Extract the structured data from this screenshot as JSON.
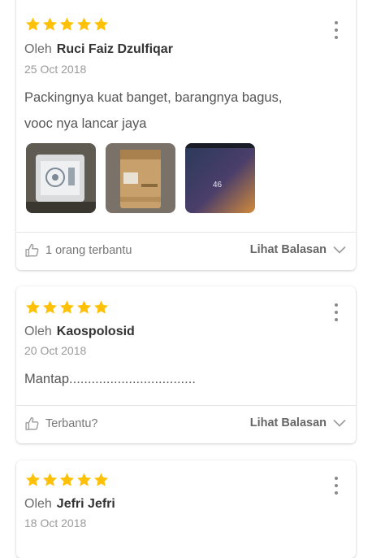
{
  "reviews": [
    {
      "rating": 5,
      "by_label": "Oleh",
      "author": "Ruci Faiz Dzulfiqar",
      "date": "25 Oct 2018",
      "text_line1": "Packingnya kuat banget, barangnya bagus,",
      "text_line2": "vooc nya lancar jaya",
      "photo_time": "46",
      "helpful": "1 orang terbantu",
      "reply": "Lihat Balasan"
    },
    {
      "rating": 5,
      "by_label": "Oleh",
      "author": "Kaospolosid",
      "date": "20 Oct 2018",
      "text_line1": "Mantap..................................",
      "helpful": "Terbantu?",
      "reply": "Lihat Balasan"
    },
    {
      "rating": 5,
      "by_label": "Oleh",
      "author": "Jefri Jefri",
      "date": "18 Oct 2018"
    }
  ],
  "colors": {
    "star": "#FFC107",
    "text": "#555555",
    "muted": "#9A9A9A"
  },
  "icons": {
    "star": "star-icon",
    "menu": "more-vertical-icon",
    "helpful": "thumbs-up-icon",
    "expand": "chevron-down-icon"
  }
}
